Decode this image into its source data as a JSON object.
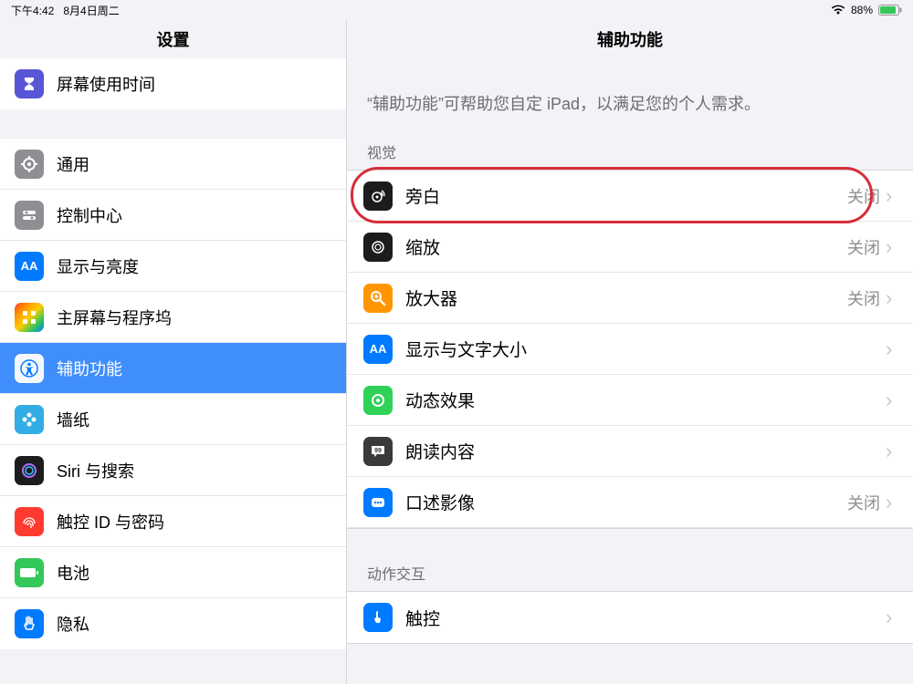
{
  "statusbar": {
    "time": "下午4:42",
    "date": "8月4日周二",
    "battery_pct": "88%"
  },
  "sidebar": {
    "title": "设置",
    "group1": [
      {
        "label": "屏幕使用时间",
        "icon": "hourglass",
        "bg": "bg-purple"
      }
    ],
    "group2": [
      {
        "label": "通用",
        "icon": "gear",
        "bg": "bg-gray"
      },
      {
        "label": "控制中心",
        "icon": "switches",
        "bg": "bg-gray"
      },
      {
        "label": "显示与亮度",
        "icon": "AA",
        "bg": "bg-blue"
      },
      {
        "label": "主屏幕与程序坞",
        "icon": "grid",
        "bg": "bg-multi"
      },
      {
        "label": "辅助功能",
        "icon": "accessibility",
        "bg": "bg-white",
        "selected": true
      },
      {
        "label": "墙纸",
        "icon": "flower",
        "bg": "bg-cyan"
      },
      {
        "label": "Siri 与搜索",
        "icon": "siri",
        "bg": "bg-black"
      },
      {
        "label": "触控 ID 与密码",
        "icon": "fingerprint",
        "bg": "bg-red"
      },
      {
        "label": "电池",
        "icon": "battery",
        "bg": "bg-green"
      },
      {
        "label": "隐私",
        "icon": "hand",
        "bg": "bg-blue"
      }
    ]
  },
  "content": {
    "title": "辅助功能",
    "intro": "“辅助功能”可帮助您自定 iPad，以满足您的个人需求。",
    "sections": [
      {
        "header": "视觉",
        "rows": [
          {
            "label": "旁白",
            "status": "关闭",
            "icon": "voiceover",
            "bg": "bg-black",
            "highlighted": true
          },
          {
            "label": "缩放",
            "status": "关闭",
            "icon": "zoom",
            "bg": "bg-black"
          },
          {
            "label": "放大器",
            "status": "关闭",
            "icon": "magnifier",
            "bg": "bg-orange"
          },
          {
            "label": "显示与文字大小",
            "status": "",
            "icon": "AA",
            "bg": "bg-blue"
          },
          {
            "label": "动态效果",
            "status": "",
            "icon": "motion",
            "bg": "bg-green2"
          },
          {
            "label": "朗读内容",
            "status": "",
            "icon": "speak",
            "bg": "bg-dark"
          },
          {
            "label": "口述影像",
            "status": "关闭",
            "icon": "desc",
            "bg": "bg-blue"
          }
        ]
      },
      {
        "header": "动作交互",
        "rows": [
          {
            "label": "触控",
            "status": "",
            "icon": "touch",
            "bg": "bg-blue"
          }
        ]
      }
    ]
  }
}
